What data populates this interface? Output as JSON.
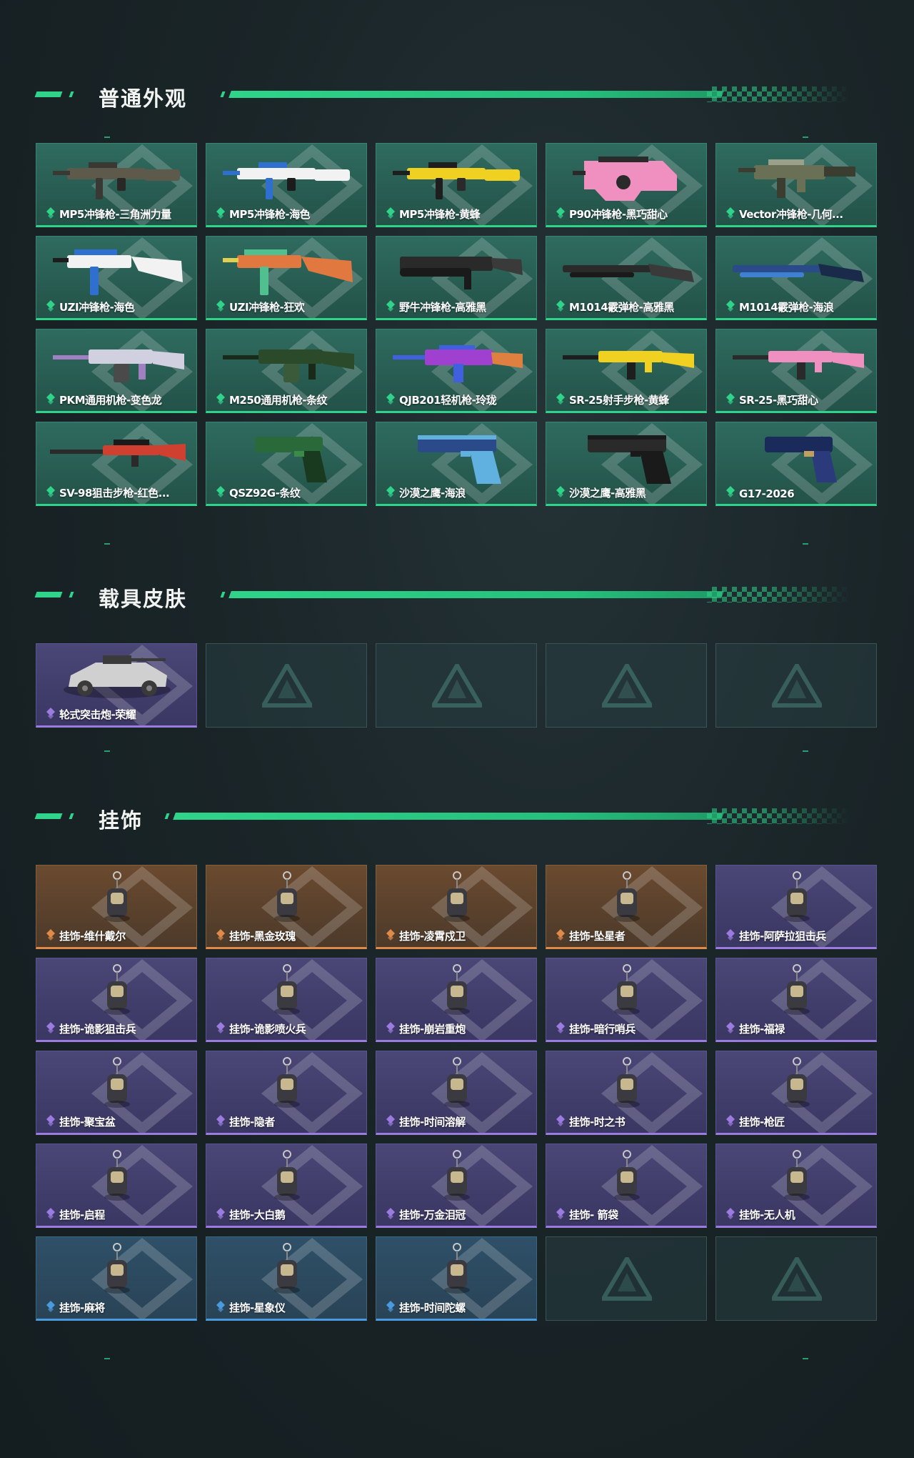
{
  "sections": {
    "weapon_skins": {
      "title": "普通外观",
      "items": [
        {
          "label": "MP5冲锋枪-三角洲力量",
          "rarity": "green",
          "icon": "smg-icon",
          "colors": [
            "#5d5a4c",
            "#3a3832",
            "#2a2826"
          ]
        },
        {
          "label": "MP5冲锋枪-海色",
          "rarity": "green",
          "icon": "smg-icon",
          "colors": [
            "#f2f2f2",
            "#2f6fd0",
            "#1c1c1c"
          ]
        },
        {
          "label": "MP5冲锋枪-黄蜂",
          "rarity": "green",
          "icon": "smg-icon",
          "colors": [
            "#f0d020",
            "#1e1e1e",
            "#2a2a2a"
          ]
        },
        {
          "label": "P90冲锋枪-黑巧甜心",
          "rarity": "green",
          "icon": "p90-icon",
          "colors": [
            "#f090c0",
            "#2a2a2a",
            "#ffffff"
          ]
        },
        {
          "label": "Vector冲锋枪-几何...",
          "rarity": "green",
          "icon": "vector-icon",
          "colors": [
            "#6a7055",
            "#3a3d30",
            "#9aa08a"
          ]
        },
        {
          "label": "UZI冲锋枪-海色",
          "rarity": "green",
          "icon": "uzi-icon",
          "colors": [
            "#f2f2f2",
            "#2f6fd0",
            "#1c1c1c"
          ]
        },
        {
          "label": "UZI冲锋枪-狂欢",
          "rarity": "green",
          "icon": "uzi-icon",
          "colors": [
            "#e07840",
            "#50c090",
            "#e0d050"
          ]
        },
        {
          "label": "野牛冲锋枪-高雅黑",
          "rarity": "green",
          "icon": "bizon-icon",
          "colors": [
            "#2a2a2a",
            "#1a1a1a",
            "#3a3a3a"
          ]
        },
        {
          "label": "M1014霰弹枪-高雅黑",
          "rarity": "green",
          "icon": "shotgun-icon",
          "colors": [
            "#2a2a2a",
            "#1a1a1a",
            "#3a3a3a"
          ]
        },
        {
          "label": "M1014霰弹枪-海浪",
          "rarity": "green",
          "icon": "shotgun-icon",
          "colors": [
            "#2a4a8a",
            "#4080d0",
            "#1a2a4a"
          ]
        },
        {
          "label": "PKM通用机枪-变色龙",
          "rarity": "green",
          "icon": "mg-icon",
          "colors": [
            "#d0d0e0",
            "#a080c0",
            "#4a4a4a"
          ]
        },
        {
          "label": "M250通用机枪-条纹",
          "rarity": "green",
          "icon": "mg-icon",
          "colors": [
            "#2a4a2a",
            "#1a2a1a",
            "#3a5a3a"
          ]
        },
        {
          "label": "QJB201轻机枪-玲珑",
          "rarity": "green",
          "icon": "lmg-icon",
          "colors": [
            "#a040d0",
            "#4060e0",
            "#e08040"
          ]
        },
        {
          "label": "SR-25射手步枪-黄蜂",
          "rarity": "green",
          "icon": "rifle-icon",
          "colors": [
            "#f0d020",
            "#1e1e1e",
            "#2a2a2a"
          ]
        },
        {
          "label": "SR-25-黑巧甜心",
          "rarity": "green",
          "icon": "rifle-icon",
          "colors": [
            "#f090c0",
            "#2a2a2a",
            "#ffffff"
          ]
        },
        {
          "label": "SV-98狙击步枪-红色...",
          "rarity": "green",
          "icon": "sniper-icon",
          "colors": [
            "#d04030",
            "#2a2a2a",
            "#1a1a1a"
          ]
        },
        {
          "label": "QSZ92G-条纹",
          "rarity": "green",
          "icon": "pistol-icon",
          "colors": [
            "#2a6a3a",
            "#1a3a20",
            "#3a8a4a"
          ]
        },
        {
          "label": "沙漠之鹰-海浪",
          "rarity": "green",
          "icon": "deagle-icon",
          "colors": [
            "#2a4a8a",
            "#60b0e0",
            "#1a2a4a"
          ]
        },
        {
          "label": "沙漠之鹰-高雅黑",
          "rarity": "green",
          "icon": "deagle-icon",
          "colors": [
            "#2a2a2a",
            "#1a1a1a",
            "#3a3a3a"
          ]
        },
        {
          "label": "G17-2026",
          "rarity": "green",
          "icon": "pistol-icon",
          "colors": [
            "#1a2a5a",
            "#2a3a7a",
            "#c0a060"
          ]
        }
      ]
    },
    "vehicle_skins": {
      "title": "载具皮肤",
      "items": [
        {
          "label": "轮式突击炮-荣耀",
          "rarity": "purple",
          "icon": "vehicle-icon",
          "colors": [
            "#d0d0d0",
            "#3a3a3a",
            "#808080"
          ]
        }
      ],
      "empty_slots": 4
    },
    "charms": {
      "title": "挂饰",
      "items": [
        {
          "label": "挂饰-维什戴尔",
          "rarity": "orange",
          "icon": "charm-icon"
        },
        {
          "label": "挂饰-黑金玫瑰",
          "rarity": "orange",
          "icon": "charm-icon"
        },
        {
          "label": "挂饰-凌霄戍卫",
          "rarity": "orange",
          "icon": "charm-icon"
        },
        {
          "label": "挂饰-坠星者",
          "rarity": "orange",
          "icon": "charm-icon"
        },
        {
          "label": "挂饰-阿萨拉狙击兵",
          "rarity": "purple",
          "icon": "charm-icon"
        },
        {
          "label": "挂饰-诡影狙击兵",
          "rarity": "purple",
          "icon": "charm-icon"
        },
        {
          "label": "挂饰-诡影喷火兵",
          "rarity": "purple",
          "icon": "charm-icon"
        },
        {
          "label": "挂饰-崩岩重炮",
          "rarity": "purple",
          "icon": "charm-icon"
        },
        {
          "label": "挂饰-暗行哨兵",
          "rarity": "purple",
          "icon": "charm-icon"
        },
        {
          "label": "挂饰-福禄",
          "rarity": "purple",
          "icon": "charm-icon"
        },
        {
          "label": "挂饰-聚宝盆",
          "rarity": "purple",
          "icon": "charm-icon"
        },
        {
          "label": "挂饰-隐者",
          "rarity": "purple",
          "icon": "charm-icon"
        },
        {
          "label": "挂饰-时间溶解",
          "rarity": "purple",
          "icon": "charm-icon"
        },
        {
          "label": "挂饰-时之书",
          "rarity": "purple",
          "icon": "charm-icon"
        },
        {
          "label": "挂饰-枪匠",
          "rarity": "purple",
          "icon": "charm-icon"
        },
        {
          "label": "挂饰-启程",
          "rarity": "purple",
          "icon": "charm-icon"
        },
        {
          "label": "挂饰-大白鹅",
          "rarity": "purple",
          "icon": "charm-icon"
        },
        {
          "label": "挂饰-万金泪冠",
          "rarity": "purple",
          "icon": "charm-icon"
        },
        {
          "label": "挂饰- 箭袋",
          "rarity": "purple",
          "icon": "charm-icon"
        },
        {
          "label": "挂饰-无人机",
          "rarity": "purple",
          "icon": "charm-icon"
        },
        {
          "label": "挂饰-麻将",
          "rarity": "blue",
          "icon": "charm-icon"
        },
        {
          "label": "挂饰-星象仪",
          "rarity": "blue",
          "icon": "charm-icon"
        },
        {
          "label": "挂饰-时间陀螺",
          "rarity": "blue",
          "icon": "charm-icon"
        }
      ],
      "empty_slots": 2
    }
  },
  "theme": {
    "accent": "#2fd48a",
    "rarity_colors": {
      "green": "#2fd48a",
      "purple": "#9b7be0",
      "orange": "#e08a4a",
      "blue": "#4a9ae0"
    }
  }
}
